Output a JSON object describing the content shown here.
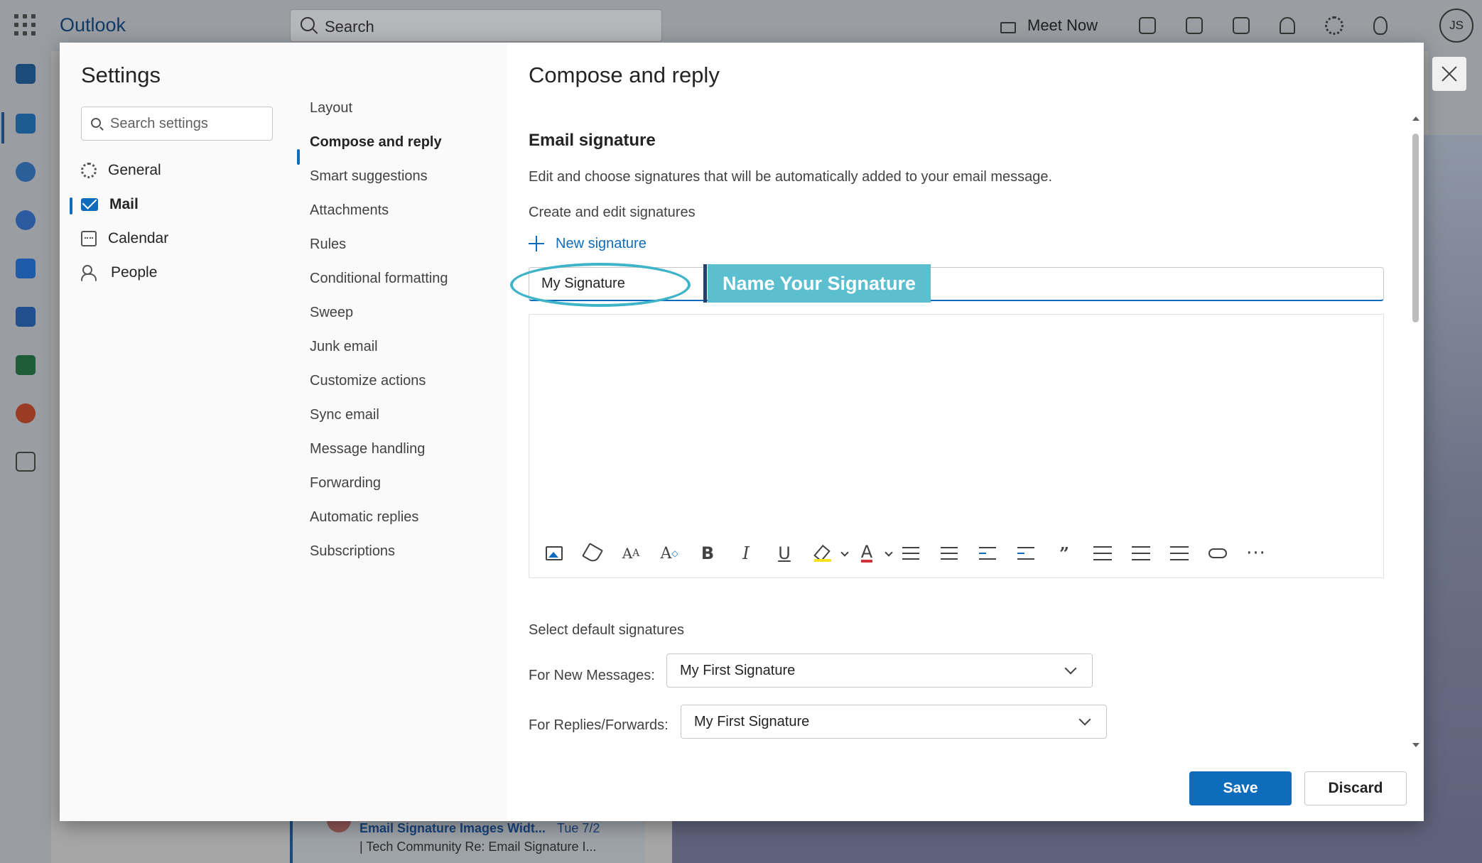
{
  "app": {
    "brand": "Outlook",
    "search_label": "Search",
    "meet_now": "Meet Now",
    "avatar_initials": "JS"
  },
  "background_mail": {
    "subject": "Email Signature Images Widt...",
    "date": "Tue 7/2",
    "preview": "| Tech Community Re: Email Signature I..."
  },
  "settings": {
    "title": "Settings",
    "search_placeholder": "Search settings",
    "categories": [
      {
        "label": "General",
        "icon": "gear-icon"
      },
      {
        "label": "Mail",
        "icon": "mail-icon",
        "selected": true
      },
      {
        "label": "Calendar",
        "icon": "calendar-icon"
      },
      {
        "label": "People",
        "icon": "people-icon"
      }
    ],
    "mail_subcategories": [
      "Layout",
      "Compose and reply",
      "Smart suggestions",
      "Attachments",
      "Rules",
      "Conditional formatting",
      "Sweep",
      "Junk email",
      "Customize actions",
      "Sync email",
      "Message handling",
      "Forwarding",
      "Automatic replies",
      "Subscriptions"
    ],
    "selected_subcategory": "Compose and reply"
  },
  "pane": {
    "title": "Compose and reply",
    "section_title": "Email signature",
    "description": "Edit and choose signatures that will be automatically added to your email message.",
    "create_edit_label": "Create and edit signatures",
    "new_signature_label": "New signature",
    "signature_name_value": "My Signature",
    "callout_label": "Name Your Signature",
    "toolbar_icons": [
      "image-icon",
      "format-painter-icon",
      "font-size-icon",
      "grow-font-icon",
      "bold-icon",
      "italic-icon",
      "underline-icon",
      "highlight-icon",
      "font-color-icon",
      "bullets-icon",
      "numbering-icon",
      "decrease-indent-icon",
      "increase-indent-icon",
      "quote-icon",
      "align-left-icon",
      "align-center-icon",
      "align-right-icon",
      "link-icon",
      "more-icon"
    ],
    "select_default_label": "Select default signatures",
    "for_new_label": "For New Messages:",
    "for_new_value": "My First Signature",
    "for_replies_label": "For Replies/Forwards:",
    "for_replies_value": "My First Signature",
    "save_label": "Save",
    "discard_label": "Discard"
  },
  "colors": {
    "accent": "#0f6cbd",
    "callout": "#5bbfd0",
    "ring": "#3fb4c8"
  }
}
